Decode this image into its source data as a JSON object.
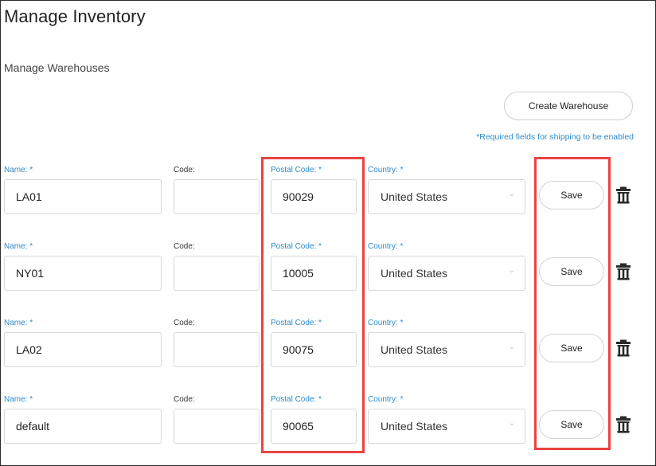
{
  "page_title": "Manage Inventory",
  "section_title": "Manage Warehouses",
  "create_button": "Create Warehouse",
  "required_note": "*Required fields for shipping to be enabled",
  "labels": {
    "name": "Name: *",
    "code": "Code:",
    "postal": "Postal Code: *",
    "country": "Country: *"
  },
  "save_label": "Save",
  "warehouses": [
    {
      "name": "LA01",
      "code": "",
      "postal": "90029",
      "country": "United States"
    },
    {
      "name": "NY01",
      "code": "",
      "postal": "10005",
      "country": "United States"
    },
    {
      "name": "LA02",
      "code": "",
      "postal": "90075",
      "country": "United States"
    },
    {
      "name": "default",
      "code": "",
      "postal": "90065",
      "country": "United States"
    }
  ],
  "colors": {
    "accent": "#2f8ac8",
    "highlight": "#e94343"
  },
  "icons": {
    "delete": "trash-icon",
    "dropdown": "chevron-down-icon"
  }
}
